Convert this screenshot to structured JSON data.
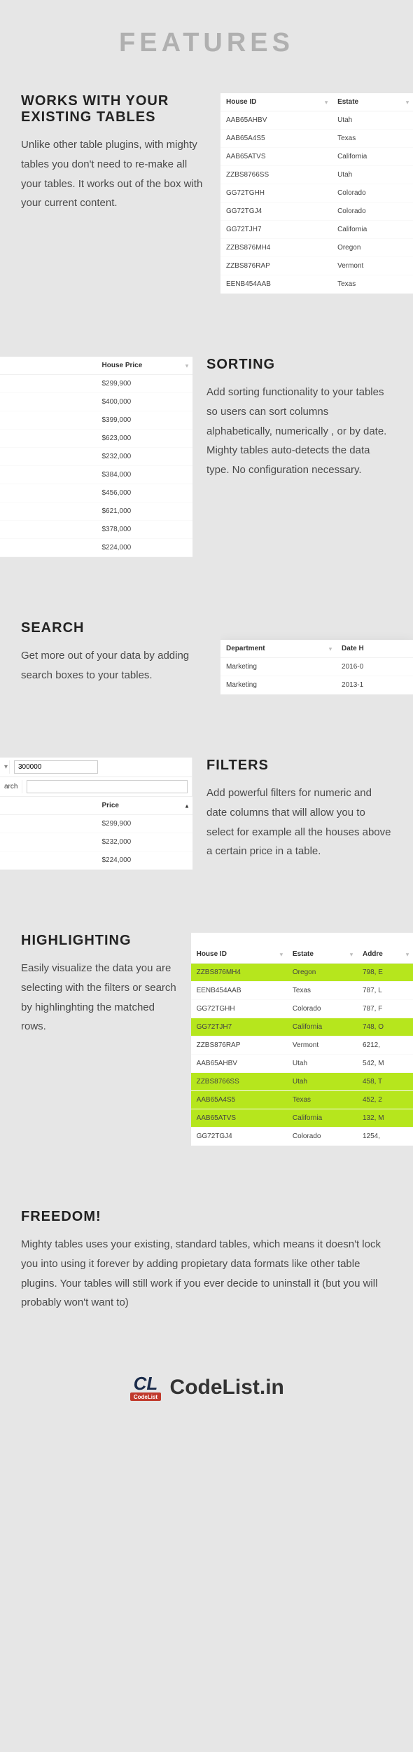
{
  "title": "FEATURES",
  "s1": {
    "heading": "WORKS WITH YOUR EXISTING TABLES",
    "body": "Unlike other table plugins, with mighty tables you don't need to re-make all your tables. It works out of the box with your current content.",
    "table": {
      "headers": [
        "House ID",
        "Estate"
      ],
      "rows": [
        [
          "AAB65AHBV",
          "Utah"
        ],
        [
          "AAB65A4S5",
          "Texas"
        ],
        [
          "AAB65ATVS",
          "California"
        ],
        [
          "ZZBS8766SS",
          "Utah"
        ],
        [
          "GG72TGHH",
          "Colorado"
        ],
        [
          "GG72TGJ4",
          "Colorado"
        ],
        [
          "GG72TJH7",
          "California"
        ],
        [
          "ZZBS876MH4",
          "Oregon"
        ],
        [
          "ZZBS876RAP",
          "Vermont"
        ],
        [
          "EENB454AAB",
          "Texas"
        ]
      ]
    }
  },
  "s2": {
    "heading": "SORTING",
    "body": "Add sorting functionality to your tables so users can sort columns alphabetically, numerically , or by date. Mighty tables auto-detects the data type. No configuration necessary.",
    "table": {
      "header": "House Price",
      "rows": [
        "$299,900",
        "$400,000",
        "$399,000",
        "$623,000",
        "$232,000",
        "$384,000",
        "$456,000",
        "$621,000",
        "$378,000",
        "$224,000"
      ]
    }
  },
  "s3": {
    "heading": "SEARCH",
    "body": "Get more out of your data by adding search boxes to your tables.",
    "table": {
      "headers": [
        "Department",
        "Date H"
      ],
      "rows": [
        [
          "Marketing",
          "2016-0"
        ],
        [
          "Marketing",
          "2013-1"
        ]
      ]
    }
  },
  "s4": {
    "heading": "FILTERS",
    "body": "Add powerful filters for numeric and date columns that will allow you to select for example all the houses above a certain price in a table.",
    "filter_value": "300000",
    "search_label": "arch",
    "table": {
      "header": "Price",
      "rows": [
        "$299,900",
        "$232,000",
        "$224,000"
      ]
    }
  },
  "s5": {
    "heading": "HIGHLIGHTING",
    "body": "Easily visualize the data you are selecting with the filters or search by highlinghting the matched rows.",
    "table": {
      "headers": [
        "House ID",
        "Estate",
        "Addre"
      ],
      "rows": [
        {
          "cells": [
            "ZZBS876MH4",
            "Oregon",
            "798, E"
          ],
          "hl": true
        },
        {
          "cells": [
            "EENB454AAB",
            "Texas",
            "787, L"
          ],
          "hl": false
        },
        {
          "cells": [
            "GG72TGHH",
            "Colorado",
            "787, F"
          ],
          "hl": false
        },
        {
          "cells": [
            "GG72TJH7",
            "California",
            "748, O"
          ],
          "hl": true
        },
        {
          "cells": [
            "ZZBS876RAP",
            "Vermont",
            "6212, "
          ],
          "hl": false
        },
        {
          "cells": [
            "AAB65AHBV",
            "Utah",
            "542, M"
          ],
          "hl": false
        },
        {
          "cells": [
            "ZZBS8766SS",
            "Utah",
            "458, T"
          ],
          "hl": true
        },
        {
          "cells": [
            "AAB65A4S5",
            "Texas",
            "452, 2"
          ],
          "hl": true
        },
        {
          "cells": [
            "AAB65ATVS",
            "California",
            "132, M"
          ],
          "hl": true
        },
        {
          "cells": [
            "GG72TGJ4",
            "Colorado",
            "1254, "
          ],
          "hl": false
        }
      ]
    }
  },
  "s6": {
    "heading": "FREEDOM!",
    "body": "Mighty tables uses your existing, standard tables, which means it doesn't lock you into using it forever by adding propietary data formats like other table plugins. Your tables will still work if you ever decide to uninstall it (but you will probably won't want to)"
  },
  "logo": {
    "mark_top": "CL",
    "mark_bottom": "CodeList",
    "text": "CodeList.in"
  }
}
